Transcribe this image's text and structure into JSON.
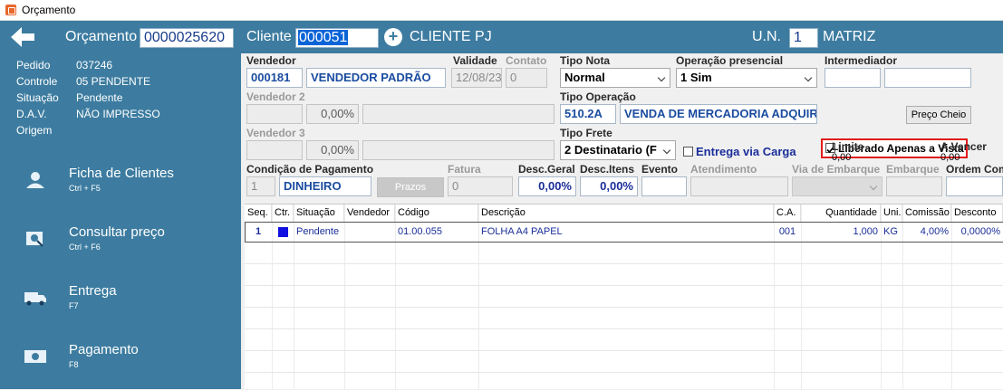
{
  "window": {
    "title": "Orçamento"
  },
  "header": {
    "orcamento_label": "Orçamento",
    "orcamento_value": "0000025620",
    "cliente_label": "Cliente",
    "cliente_code": "000051",
    "cliente_name": "CLIENTE PJ",
    "un_label": "U.N.",
    "un_value": "1",
    "un_name": "MATRIZ"
  },
  "sidebar": {
    "info": [
      {
        "key": "Pedido",
        "value": "037246"
      },
      {
        "key": "Controle",
        "value": "05  PENDENTE"
      },
      {
        "key": "Situação",
        "value": "Pendente"
      },
      {
        "key": "D.A.V.",
        "value": "NÃO IMPRESSO"
      },
      {
        "key": "Origem",
        "value": ""
      }
    ],
    "menu": [
      {
        "title": "Ficha de Clientes",
        "shortcut": "Ctrl + F5",
        "icon": "user-icon"
      },
      {
        "title": "Consultar preço",
        "shortcut": "Ctrl + F6",
        "icon": "search-price-icon"
      },
      {
        "title": "Entrega",
        "shortcut": "F7",
        "icon": "truck-icon"
      },
      {
        "title": "Pagamento",
        "shortcut": "F8",
        "icon": "money-icon"
      }
    ]
  },
  "form": {
    "vendedor_label": "Vendedor",
    "vendedor_code": "000181",
    "vendedor_name": "VENDEDOR PADRÃO",
    "validade_label": "Validade",
    "validade_value": "12/08/23",
    "contato_label": "Contato",
    "contato_value": "0",
    "tipo_nota_label": "Tipo Nota",
    "tipo_nota_value": "Normal",
    "operacao_label": "Operação presencial",
    "operacao_value": "1 Sim",
    "intermediador_label": "Intermediador",
    "liberado_label": "Liberado Apenas a Vista",
    "vendedor2_label": "Vendedor 2",
    "vendedor2_pct": "0,00%",
    "tipo_operacao_label": "Tipo Operação",
    "tipo_operacao_code": "510.2A",
    "tipo_operacao_name": "VENDA DE MERCADORIA ADQUIRI",
    "preco_cheio_label": "Preço Cheio",
    "vendedor3_label": "Vendedor 3",
    "vendedor3_pct": "0,00%",
    "tipo_frete_label": "Tipo Frete",
    "tipo_frete_value": "2 Destinatario (F",
    "entrega_carga_label": "Entrega via Carga",
    "limite_label": "Limite",
    "limite_value": "0,00",
    "a_vencer_label": "A Vencer",
    "a_vencer_value": "0,00",
    "cond_pag_label": "Condição de Pagamento",
    "cond_pag_code": "1",
    "cond_pag_name": "DINHEIRO",
    "prazos_label": "Prazos",
    "fatura_label": "Fatura",
    "fatura_value": "0",
    "desc_geral_label": "Desc.Geral",
    "desc_geral_value": "0,00%",
    "desc_itens_label": "Desc.Itens",
    "desc_itens_value": "0,00%",
    "evento_label": "Evento",
    "atendimento_label": "Atendimento",
    "via_embarque_label": "Via de Embarque",
    "embarque_label": "Embarque",
    "ordem_label": "Ordem Com"
  },
  "grid": {
    "columns": [
      "Seq.",
      "Ctr.",
      "Situação",
      "Vendedor",
      "Código",
      "Descrição",
      "C.A.",
      "Quantidade",
      "Uni.",
      "Comissão",
      "Desconto"
    ],
    "rows": [
      {
        "seq": "1",
        "situacao": "Pendente",
        "vendedor": "",
        "codigo": "01.00.055",
        "descricao": "FOLHA A4 PAPEL",
        "ca": "001",
        "quantidade": "1,000",
        "uni": "KG",
        "comissao": "4,00%",
        "desconto": "0,0000%"
      }
    ]
  },
  "colors": {
    "header": "#3d7ca0",
    "field_text": "#1a4ca0",
    "highlight": "#e21b1b",
    "ctr_marker": "#1010e0"
  }
}
